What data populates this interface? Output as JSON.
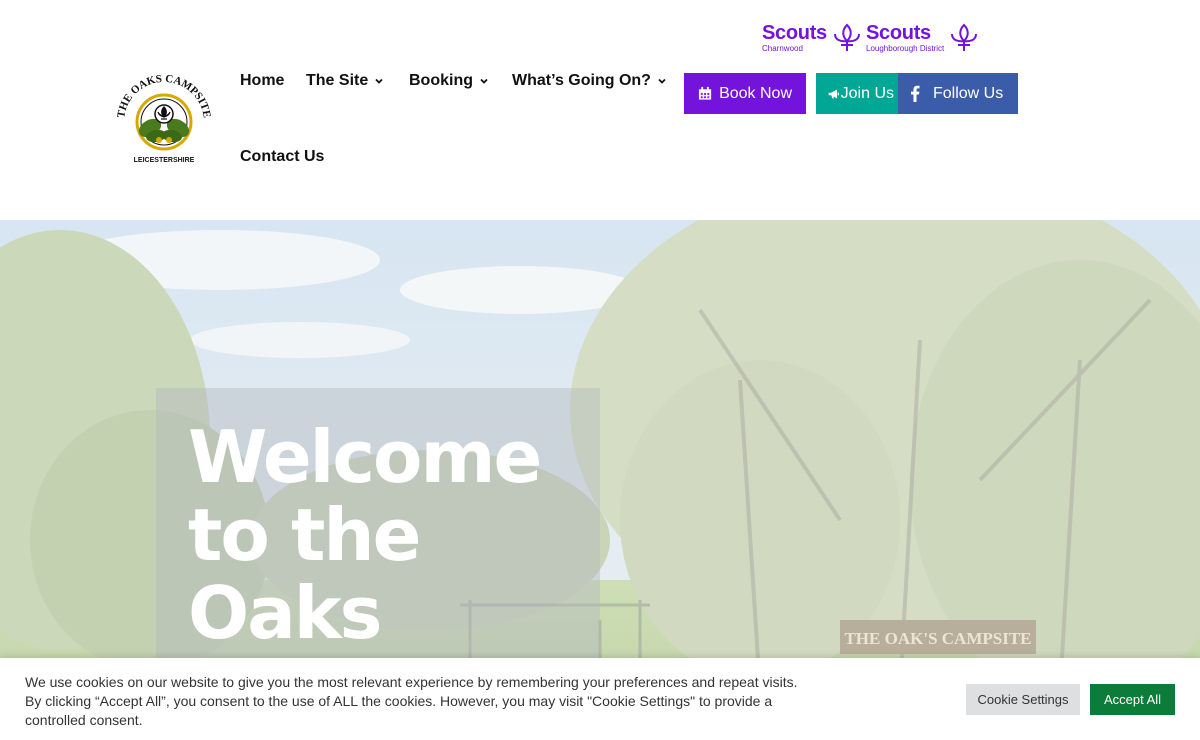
{
  "logo": {
    "arc_text": "THE OAKS CAMPSITE",
    "bottom_text": "LEICESTERSHIRE"
  },
  "nav": {
    "items": [
      {
        "label": "Home",
        "has_dropdown": false
      },
      {
        "label": "The Site",
        "has_dropdown": true
      },
      {
        "label": "Booking",
        "has_dropdown": true
      },
      {
        "label": "What’s Going On?",
        "has_dropdown": true
      },
      {
        "label": "Contact Us",
        "has_dropdown": false
      }
    ]
  },
  "scouts_logos": [
    {
      "name": "Scouts",
      "district": "Charnwood"
    },
    {
      "name": "Scouts",
      "district": "Loughborough District"
    }
  ],
  "buttons": {
    "book_now": "Book Now",
    "join_us": "Join Us",
    "follow_us": "Follow Us"
  },
  "hero": {
    "title_line1": "Welcome",
    "title_line2": "to the",
    "title_line3": "Oaks",
    "sign_text": "THE OAK'S CAMPSITE"
  },
  "cookie": {
    "text": "We use cookies on our website to give you the most relevant experience by remembering your preferences and repeat visits. By clicking “Accept All”, you consent to the use of ALL the cookies. However, you may visit \"Cookie Settings\" to provide a controlled consent.",
    "settings_label": "Cookie Settings",
    "accept_label": "Accept All"
  },
  "colors": {
    "scouts_purple": "#7413dc",
    "teal": "#00a794",
    "facebook_blue": "#3b5ca8",
    "accept_green": "#0b7c39"
  }
}
